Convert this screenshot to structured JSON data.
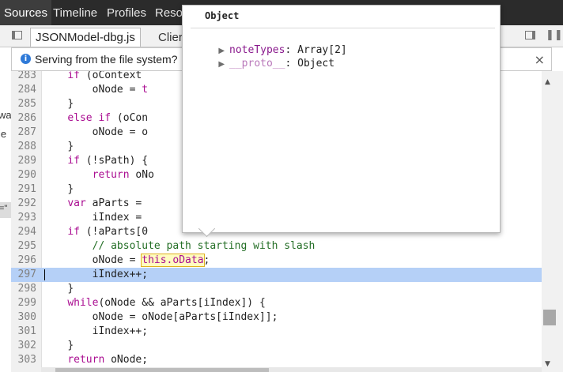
{
  "top_tabs": [
    "Sources",
    "Timeline",
    "Profiles",
    "Reso"
  ],
  "file_tabs": {
    "active": "JSONModel-dbg.js",
    "inactive": "Clier"
  },
  "infobar": {
    "message": "Serving from the file system?",
    "close": "×"
  },
  "left_fragments": [
    "wa",
    "ie",
    "=\""
  ],
  "editor": {
    "lines": [
      {
        "num": "283",
        "indent": "    ",
        "parts": [
          {
            "t": "if",
            "c": "kw"
          },
          {
            "t": " (oContext"
          }
        ]
      },
      {
        "num": "284",
        "indent": "        ",
        "parts": [
          {
            "t": "oNode = "
          },
          {
            "t": "t",
            "c": "kw"
          }
        ]
      },
      {
        "num": "285",
        "indent": "    ",
        "parts": [
          {
            "t": "}"
          }
        ]
      },
      {
        "num": "286",
        "indent": "    ",
        "parts": [
          {
            "t": "else",
            "c": "kw"
          },
          {
            "t": " "
          },
          {
            "t": "if",
            "c": "kw"
          },
          {
            "t": " (oCon"
          }
        ]
      },
      {
        "num": "287",
        "indent": "        ",
        "parts": [
          {
            "t": "oNode = o"
          }
        ]
      },
      {
        "num": "288",
        "indent": "    ",
        "parts": [
          {
            "t": "}"
          }
        ]
      },
      {
        "num": "289",
        "indent": "    ",
        "parts": [
          {
            "t": "if",
            "c": "kw"
          },
          {
            "t": " (!sPath) {"
          }
        ]
      },
      {
        "num": "290",
        "indent": "        ",
        "parts": [
          {
            "t": "return",
            "c": "kw"
          },
          {
            "t": " oNo"
          }
        ]
      },
      {
        "num": "291",
        "indent": "    ",
        "parts": [
          {
            "t": "}"
          }
        ]
      },
      {
        "num": "292",
        "indent": "    ",
        "parts": [
          {
            "t": "var",
            "c": "kw"
          },
          {
            "t": " aParts ="
          }
        ]
      },
      {
        "num": "293",
        "indent": "        ",
        "parts": [
          {
            "t": "iIndex ="
          }
        ]
      },
      {
        "num": "294",
        "indent": "    ",
        "parts": [
          {
            "t": "if",
            "c": "kw"
          },
          {
            "t": " (!aParts[0"
          }
        ]
      },
      {
        "num": "295",
        "indent": "        ",
        "parts": [
          {
            "t": "// absolute path starting with slash",
            "c": "cm"
          }
        ]
      },
      {
        "num": "296",
        "indent": "        ",
        "parts": [
          {
            "t": "oNode = "
          },
          {
            "t": "this.oData",
            "c": "hover"
          },
          {
            "t": ";"
          }
        ]
      },
      {
        "num": "297",
        "indent": "        ",
        "parts": [
          {
            "t": "iIndex++;"
          }
        ],
        "highlight": true
      },
      {
        "num": "298",
        "indent": "    ",
        "parts": [
          {
            "t": "}"
          }
        ]
      },
      {
        "num": "299",
        "indent": "    ",
        "parts": [
          {
            "t": "while",
            "c": "kw"
          },
          {
            "t": "(oNode && aParts[iIndex]) {"
          }
        ]
      },
      {
        "num": "300",
        "indent": "        ",
        "parts": [
          {
            "t": "oNode = oNode[aParts[iIndex]];"
          }
        ]
      },
      {
        "num": "301",
        "indent": "        ",
        "parts": [
          {
            "t": "iIndex++;"
          }
        ]
      },
      {
        "num": "302",
        "indent": "    ",
        "parts": [
          {
            "t": "}"
          }
        ]
      },
      {
        "num": "303",
        "indent": "    ",
        "parts": [
          {
            "t": "return",
            "c": "kw"
          },
          {
            "t": " oNode;"
          }
        ]
      }
    ]
  },
  "popover": {
    "title": "Object",
    "rows": [
      {
        "key": "noteTypes",
        "value": "Array[2]",
        "proto": false
      },
      {
        "key": "__proto__",
        "value": "Object",
        "proto": true
      }
    ]
  },
  "colors": {
    "keyword": "#aa0d91",
    "comment": "#236e25",
    "highlight": "#b5d0f7",
    "info": "#2f7ad8"
  },
  "icons": [
    "panel-toggle-left-icon",
    "info-icon",
    "close-icon",
    "panel-toggle-right-icon",
    "pause-icon",
    "expand-triangle-icon"
  ]
}
